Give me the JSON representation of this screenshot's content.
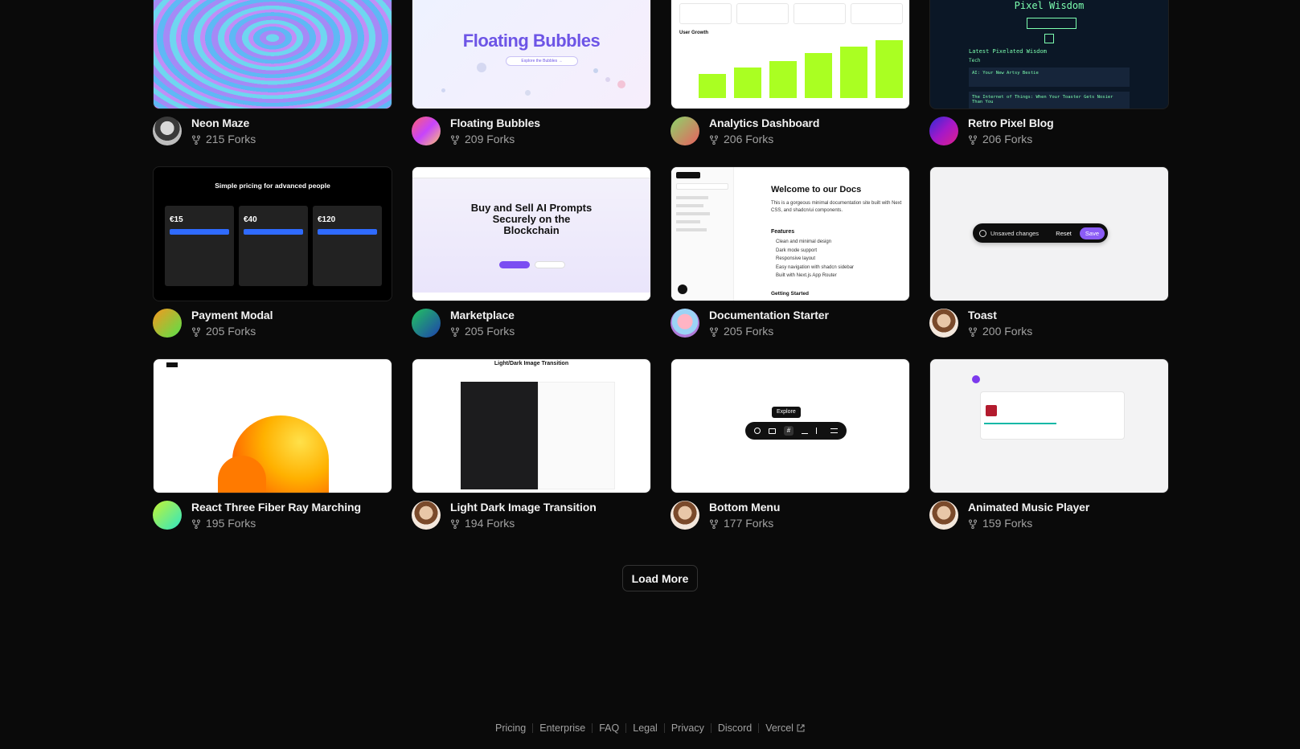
{
  "gallery": {
    "fork_suffix": "Forks",
    "rows": [
      [
        {
          "title": "Neon Maze",
          "forks": "215 Forks"
        },
        {
          "title": "Floating Bubbles",
          "forks": "209 Forks",
          "thumb_text": "Floating Bubbles",
          "thumb_button": "Explore the Bubbles →"
        },
        {
          "title": "Analytics Dashboard",
          "forks": "206 Forks",
          "thumb_text": "User Growth"
        },
        {
          "title": "Retro Pixel Blog",
          "forks": "206 Forks",
          "thumb_text": "Pixel Wisdom",
          "thumb_sub": "Latest Pixelated Wisdom",
          "thumb_tag": "Tech",
          "thumb_post1": "AI: Your New Artsy Bestie",
          "thumb_post2": "The Internet of Things: When Your Toaster Gets Nosier Than You"
        }
      ],
      [
        {
          "title": "Payment Modal",
          "forks": "205 Forks",
          "thumb_text": "Simple pricing for advanced people",
          "prices": [
            "€15",
            "€40",
            "€120"
          ]
        },
        {
          "title": "Marketplace",
          "forks": "205 Forks",
          "thumb_text": "Buy and Sell AI Prompts Securely on the Blockchain"
        },
        {
          "title": "Documentation Starter",
          "forks": "205 Forks",
          "thumb_text": "Welcome to our Docs",
          "thumb_sub": "This is a gorgeous minimal documentation site built with Next CSS, and shadcn/ui components.",
          "features_title": "Features",
          "features": [
            "Clean and minimal design",
            "Dark mode support",
            "Responsive layout",
            "Easy navigation with shadcn sidebar",
            "Built with Next.js App Router"
          ],
          "getting_started": "Getting Started"
        },
        {
          "title": "Toast",
          "forks": "200 Forks",
          "toast_text": "Unsaved changes",
          "toast_reset": "Reset",
          "toast_save": "Save"
        }
      ],
      [
        {
          "title": "React Three Fiber Ray Marching",
          "forks": "195 Forks"
        },
        {
          "title": "Light Dark Image Transition",
          "forks": "194 Forks",
          "thumb_text": "Light/Dark Image Transition"
        },
        {
          "title": "Bottom Menu",
          "forks": "177 Forks",
          "tooltip": "Explore"
        },
        {
          "title": "Animated Music Player",
          "forks": "159 Forks"
        }
      ]
    ]
  },
  "load_more": "Load More",
  "footer": {
    "links": [
      "Pricing",
      "Enterprise",
      "FAQ",
      "Legal",
      "Privacy",
      "Discord",
      "Vercel"
    ]
  },
  "colors": {
    "background": "#0a0a0a",
    "bubbles_accent": "#6d55e6",
    "chart_bar": "#aaff22",
    "retro_text": "#7dffb0"
  }
}
